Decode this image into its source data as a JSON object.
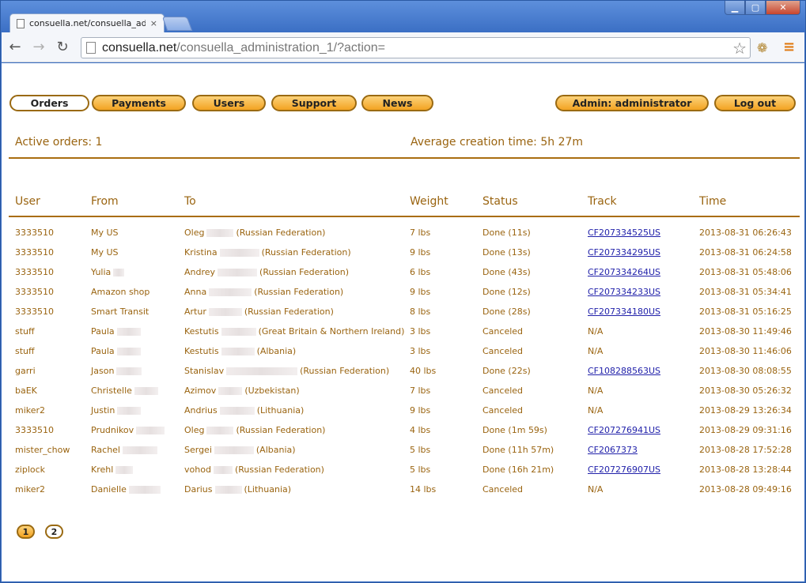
{
  "browser": {
    "tab_title": "consuella.net/consuella_adm",
    "tab_close": "×",
    "url_host": "consuella.net",
    "url_path": "/consuella_administration_1/?action=",
    "window_min": "▁",
    "window_max": "▢",
    "window_close": "✕",
    "back": "←",
    "forward": "→",
    "reload": "↻",
    "star": "☆",
    "extension": "❁",
    "menu": "≡"
  },
  "nav": {
    "orders": "Orders",
    "payments": "Payments",
    "users": "Users",
    "support": "Support",
    "news": "News",
    "admin": "Admin: administrator",
    "logout": "Log out"
  },
  "summary": {
    "active_orders": "Active orders: 1",
    "avg_time": "Average creation time: 5h 27m"
  },
  "table": {
    "headers": {
      "user": "User",
      "from": "From",
      "to": "To",
      "weight": "Weight",
      "status": "Status",
      "track": "Track",
      "time": "Time"
    },
    "rows": [
      {
        "user": "3333510",
        "from": "My US",
        "to_name": "Oleg",
        "to_country": "(Russian Federation)",
        "weight": "7 lbs",
        "status": "Done (11s)",
        "track": "CF207334525US",
        "time": "2013-08-31 06:26:43"
      },
      {
        "user": "3333510",
        "from": "My US",
        "to_name": "Kristina",
        "to_country": "(Russian Federation)",
        "weight": "9 lbs",
        "status": "Done (13s)",
        "track": "CF207334295US",
        "time": "2013-08-31 06:24:58"
      },
      {
        "user": "3333510",
        "from": "Yulia",
        "to_name": "Andrey",
        "to_country": "(Russian Federation)",
        "weight": "6 lbs",
        "status": "Done (43s)",
        "track": "CF207334264US",
        "time": "2013-08-31 05:48:06"
      },
      {
        "user": "3333510",
        "from": "Amazon shop",
        "to_name": "Anna",
        "to_country": "(Russian Federation)",
        "weight": "9 lbs",
        "status": "Done (12s)",
        "track": "CF207334233US",
        "time": "2013-08-31 05:34:41"
      },
      {
        "user": "3333510",
        "from": "Smart Transit",
        "to_name": "Artur",
        "to_country": "(Russian Federation)",
        "weight": "8 lbs",
        "status": "Done (28s)",
        "track": "CF207334180US",
        "time": "2013-08-31 05:16:25"
      },
      {
        "user": "stuff",
        "from": "Paula",
        "to_name": "Kestutis",
        "to_country": "(Great Britain & Northern Ireland)",
        "weight": "3 lbs",
        "status": "Canceled",
        "track": "N/A",
        "time": "2013-08-30 11:49:46"
      },
      {
        "user": "stuff",
        "from": "Paula",
        "to_name": "Kestutis",
        "to_country": "(Albania)",
        "weight": "3 lbs",
        "status": "Canceled",
        "track": "N/A",
        "time": "2013-08-30 11:46:06"
      },
      {
        "user": "garri",
        "from": "Jason",
        "to_name": "Stanislav",
        "to_country": "(Russian Federation)",
        "weight": "40 lbs",
        "status": "Done (22s)",
        "track": "CF108288563US",
        "time": "2013-08-30 08:08:55"
      },
      {
        "user": "baEK",
        "from": "Christelle",
        "to_name": "Azimov",
        "to_country": "(Uzbekistan)",
        "weight": "7 lbs",
        "status": "Canceled",
        "track": "N/A",
        "time": "2013-08-30 05:26:32"
      },
      {
        "user": "miker2",
        "from": "Justin",
        "to_name": "Andrius",
        "to_country": "(Lithuania)",
        "weight": "9 lbs",
        "status": "Canceled",
        "track": "N/A",
        "time": "2013-08-29 13:26:34"
      },
      {
        "user": "3333510",
        "from": "Prudnikov",
        "to_name": "Oleg",
        "to_country": "(Russian Federation)",
        "weight": "4 lbs",
        "status": "Done (1m 59s)",
        "track": "CF207276941US",
        "time": "2013-08-29 09:31:16"
      },
      {
        "user": "mister_chow",
        "from": "Rachel",
        "to_name": "Sergei",
        "to_country": "(Albania)",
        "weight": "5 lbs",
        "status": "Done (11h 57m)",
        "track": "CF2067373",
        "time": "2013-08-28 17:52:28"
      },
      {
        "user": "ziplock",
        "from": "Krehl",
        "to_name": "vohod",
        "to_country": "(Russian Federation)",
        "weight": "5 lbs",
        "status": "Done (16h 21m)",
        "track": "CF207276907US",
        "time": "2013-08-28 13:28:44"
      },
      {
        "user": "miker2",
        "from": "Danielle",
        "to_name": "Darius",
        "to_country": "(Lithuania)",
        "weight": "14 lbs",
        "status": "Canceled",
        "track": "N/A",
        "time": "2013-08-28 09:49:16"
      }
    ]
  },
  "pagination": [
    "1",
    "2"
  ]
}
